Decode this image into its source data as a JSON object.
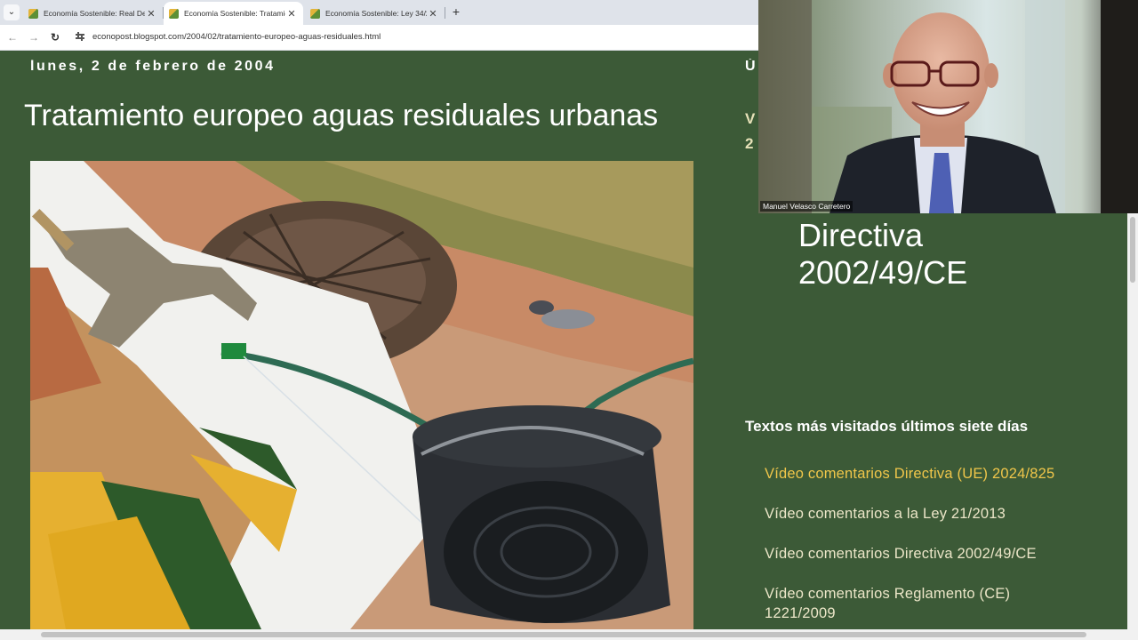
{
  "browser": {
    "tabs": [
      {
        "title": "Economía Sostenible: Real Dec",
        "active": false
      },
      {
        "title": "Economía Sostenible: Tratamie",
        "active": true
      },
      {
        "title": "Economía Sostenible: Ley 34/2",
        "active": false
      }
    ],
    "close_glyph": "✕",
    "new_tab_glyph": "+",
    "menu_glyph": "⌄",
    "back_glyph": "←",
    "forward_glyph": "→",
    "reload_glyph": "↻",
    "url": "econopost.blogspot.com/2004/02/tratamiento-europeo-aguas-residuales.html"
  },
  "post": {
    "date": "lunes, 2 de febrero de 2004",
    "title": "Tratamiento europeo aguas residuales urbanas"
  },
  "sidebar": {
    "partial_heading": "Ú",
    "partial_item": [
      "V",
      "2"
    ],
    "video_title": [
      "Directiva",
      "2002/49/CE"
    ],
    "popular_heading": "Textos más visitados últimos siete días",
    "popular_items": [
      "Vídeo comentarios Directiva (UE) 2024/825",
      "Vídeo comentarios a la Ley 21/2013",
      "Vídeo comentarios Directiva 2002/49/CE",
      "Vídeo comentarios Reglamento (CE) 1221/2009"
    ]
  },
  "webcam": {
    "participant_name": "Manuel Velasco Carretero"
  },
  "colors": {
    "page_bg": "#3c5a37",
    "link": "#ece6c8",
    "link_current": "#f0c64a"
  }
}
